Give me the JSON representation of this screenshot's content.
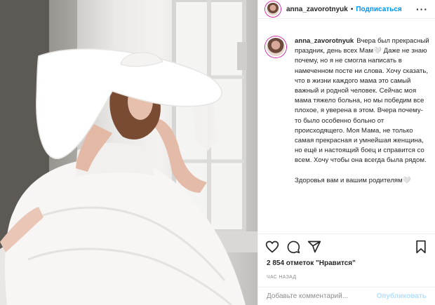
{
  "post": {
    "username": "anna_zavorotnyuk",
    "separator": "•",
    "follow_label": "Подписаться",
    "more_label": "···",
    "caption_username": "anna_zavorotnyuk",
    "caption_text": "Вчера был прекрасный праздник, день всех Мам🤍 Даже не знаю почему, но я не смогла написать в намеченном посте ни слова. Хочу сказать, что в жизни каждого мама это самый важный и родной человек. Сейчас моя мама тяжело больна, но мы победим все плохое, я уверена в этом. Вчера почему-то было особенно больно от происходящего. Моя Мама, не только самая прекрасная и умнейшая женщина, но ещё и настоящий боец и справится со всем. Хочу чтобы она всегда была рядом.",
    "caption_text_2": "Здоровья вам и вашим родителям🤍",
    "likes": "2 854 отметок \"Нравится\"",
    "time": "ЧАС НАЗАД",
    "comment_placeholder": "Добавьте комментарий...",
    "publish_label": "Опубликовать"
  },
  "icons": {
    "like": "heart-icon",
    "comment": "comment-icon",
    "share": "share-icon",
    "save": "bookmark-icon",
    "more": "more-icon"
  },
  "colors": {
    "link_blue": "#0095f6",
    "publish_disabled": "#b2dffc",
    "meta_grey": "#8e8e8e",
    "text": "#262626"
  }
}
